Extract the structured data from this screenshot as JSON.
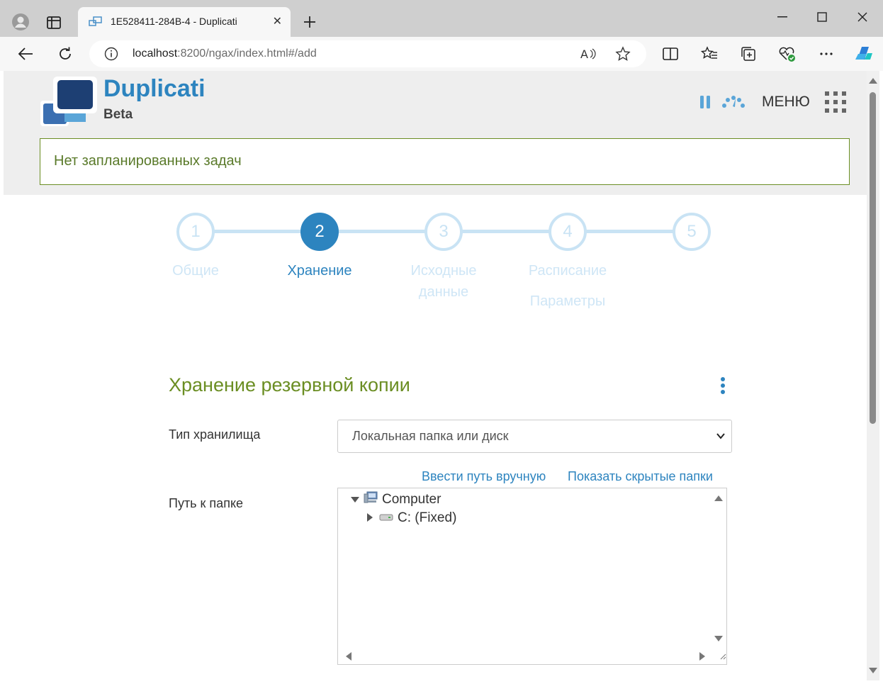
{
  "browser": {
    "tab_title": "1E528411-284B-4 - Duplicati",
    "url_host": "localhost",
    "url_rest": ":8200/ngax/index.html#/add"
  },
  "header": {
    "brand_name": "Duplicati",
    "brand_sub": "Beta",
    "menu_label": "МЕНЮ",
    "notice": "Нет запланированных задач"
  },
  "steps": [
    {
      "number": "1",
      "label_line1": "Общие",
      "label_line2": "",
      "active": false
    },
    {
      "number": "2",
      "label_line1": "Хранение",
      "label_line2": "",
      "active": true
    },
    {
      "number": "3",
      "label_line1": "Исходные",
      "label_line2": "данные",
      "active": false
    },
    {
      "number": "4",
      "label_line1": "Расписание",
      "label_line2": "",
      "active": false
    },
    {
      "number": "5",
      "label_line1": "Параметры",
      "label_line2": "",
      "active": false
    }
  ],
  "form": {
    "section_title": "Хранение резервной копии",
    "storage_type_label": "Тип хранилища",
    "storage_type_value": "Локальная папка или диск",
    "manual_path_link": "Ввести путь вручную",
    "show_hidden_link": "Показать скрытые папки",
    "folder_path_label": "Путь к папке",
    "tree": [
      {
        "label": "Computer",
        "expanded": true
      },
      {
        "label": "C: (Fixed)",
        "expanded": false
      }
    ]
  },
  "colors": {
    "accent": "#2d84bf",
    "green": "#6b8e23",
    "step_inactive": "#c9e3f4"
  }
}
